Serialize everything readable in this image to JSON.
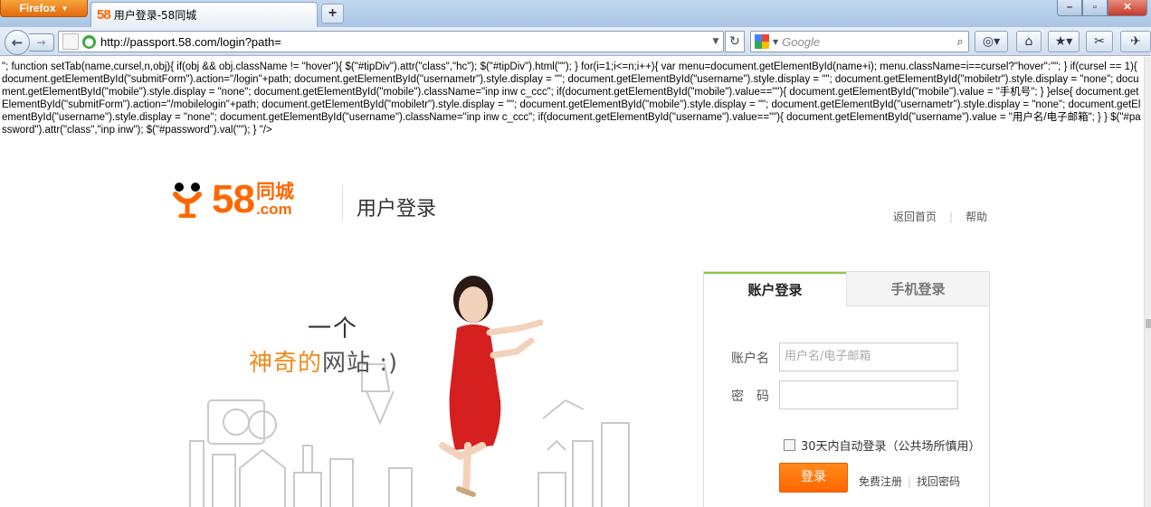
{
  "browser": {
    "menu_label": "Firefox",
    "tab": {
      "favicon_text": "58",
      "title": "用户登录-58同城"
    },
    "new_tab_label": "+",
    "window_controls": {
      "minimize": "–",
      "maximize": "▫",
      "close": "✕"
    },
    "url": "http://passport.58.com/login?path=",
    "search_placeholder": "Google"
  },
  "leaked_code": "\"; function setTab(name,cursel,n,obj){ if(obj && obj.className != \"hover\"){ $(\"#tipDiv\").attr(\"class\",\"hc\"); $(\"#tipDiv\").html(\"\"); } for(i=1;i<=n;i++){ var menu=document.getElementById(name+i); menu.className=i==cursel?\"hover\":\"\"; } if(cursel == 1){ document.getElementById(\"submitForm\").action=\"/login\"+path; document.getElementById(\"usernametr\").style.display = \"\"; document.getElementById(\"username\").style.display = \"\"; document.getElementById(\"mobiletr\").style.display = \"none\"; document.getElementById(\"mobile\").style.display = \"none\"; document.getElementById(\"mobile\").className=\"inp inw c_ccc\"; if(document.getElementById(\"mobile\").value==\"\"){ document.getElementById(\"mobile\").value = \"手机号\"; } }else{ document.getElementById(\"submitForm\").action=\"/mobilelogin\"+path; document.getElementById(\"mobiletr\").style.display = \"\"; document.getElementById(\"mobile\").style.display = \"\"; document.getElementById(\"usernametr\").style.display = \"none\"; document.getElementById(\"username\").style.display = \"none\"; document.getElementById(\"username\").className=\"inp inw c_ccc\"; if(document.getElementById(\"username\").value==\"\"){ document.getElementById(\"username\").value = \"用户名/电子邮箱\"; } } $(\"#password\").attr(\"class\",\"inp inw\"); $(\"#password\").val(\"\"); } \"/>",
  "header": {
    "logo_number": "58",
    "logo_cn": "同城",
    "logo_com": ".com",
    "page_title": "用户登录",
    "links": {
      "home": "返回首页",
      "help": "帮助"
    }
  },
  "banner": {
    "slogan_line1": "一个",
    "slogan_line2_orange": "神奇的",
    "slogan_line2_dark": "网站 :)"
  },
  "login": {
    "tab_account": "账户登录",
    "tab_mobile": "手机登录",
    "account_label": "账户名",
    "account_placeholder": "用户名/电子邮箱",
    "password_label": "密　码",
    "remember_label": "30天内自动登录（公共场所慎用）",
    "submit_label": "登录",
    "register_link": "免费注册",
    "forgot_link": "找回密码"
  },
  "colors": {
    "brand_orange": "#ff6600",
    "tab_accent_green": "#8cc63f",
    "firefox_orange": "#e26b0c"
  }
}
